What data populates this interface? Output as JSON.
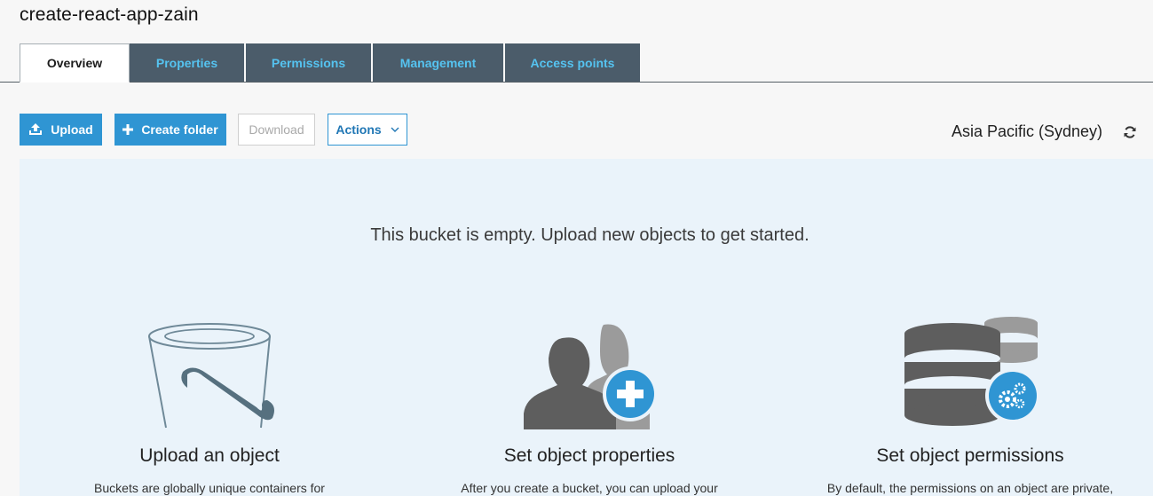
{
  "bucket": {
    "name": "create-react-app-zain"
  },
  "tabs": [
    {
      "label": "Overview",
      "active": true
    },
    {
      "label": "Properties"
    },
    {
      "label": "Permissions"
    },
    {
      "label": "Management"
    },
    {
      "label": "Access points"
    }
  ],
  "toolbar": {
    "upload_label": "Upload",
    "create_folder_label": "Create folder",
    "download_label": "Download",
    "actions_label": "Actions"
  },
  "region": "Asia Pacific (Sydney)",
  "empty_state": {
    "message": "This bucket is empty. Upload new objects to get started.",
    "cards": [
      {
        "heading": "Upload an object",
        "desc": "Buckets are globally unique containers for",
        "icon": "bucket-icon"
      },
      {
        "heading": "Set object properties",
        "desc": "After you create a bucket, you can upload your",
        "icon": "users-add-icon"
      },
      {
        "heading": "Set object permissions",
        "desc": "By default, the permissions on an object are private,",
        "icon": "database-gear-icon"
      }
    ]
  },
  "colors": {
    "primary": "#2f95d3",
    "tab_bg": "#4b5c6a",
    "tab_text": "#55c3f0",
    "panel_bg": "#eaf3fa"
  }
}
